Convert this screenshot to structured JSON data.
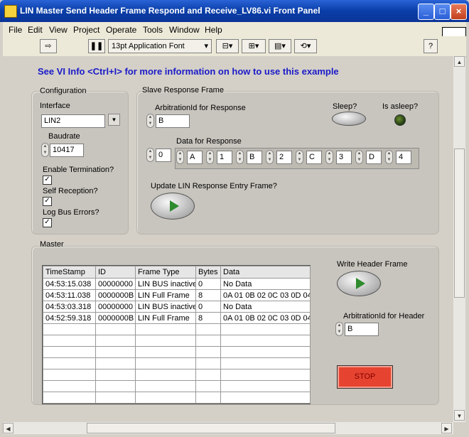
{
  "window": {
    "title": "LIN Master Send Header Frame Respond and Receive_LV86.vi Front Panel"
  },
  "menu": [
    "File",
    "Edit",
    "View",
    "Project",
    "Operate",
    "Tools",
    "Window",
    "Help"
  ],
  "toolbar": {
    "font_label": "13pt Application Font"
  },
  "info_text": "See VI Info <Ctrl+I> for more information on how to use this example",
  "configuration": {
    "title": "Configuration",
    "interface_label": "Interface",
    "interface_value": "LIN2",
    "baudrate_label": "Baudrate",
    "baudrate_value": "10417",
    "enable_termination_label": "Enable Termination?",
    "self_reception_label": "Self Reception?",
    "log_bus_errors_label": "Log Bus Errors?",
    "check_mark": "✓"
  },
  "slave": {
    "title": "Slave Response Frame",
    "arb_id_label": "ArbitrationId for Response",
    "arb_id_value": "B",
    "sleep_label": "Sleep?",
    "asleep_label": "Is asleep?",
    "data_label": "Data for Response",
    "data_index": "0",
    "data_values": [
      "A",
      "1",
      "B",
      "2",
      "C",
      "3",
      "D",
      "4"
    ],
    "update_label": "Update LIN Response Entry Frame?"
  },
  "master": {
    "title": "Master",
    "columns": [
      "TimeStamp",
      "ID",
      "Frame Type",
      "Bytes",
      "Data"
    ],
    "rows": [
      [
        "04:53:15.038",
        "00000000",
        "LIN BUS inactive",
        "0",
        "No Data"
      ],
      [
        "04:53:11.038",
        "0000000B",
        "LIN Full Frame",
        "8",
        "0A 01 0B 02 0C 03 0D 04"
      ],
      [
        "04:53:03.318",
        "00000000",
        "LIN BUS inactive",
        "0",
        "No Data"
      ],
      [
        "04:52:59.318",
        "0000000B",
        "LIN Full Frame",
        "8",
        "0A 01 0B 02 0C 03 0D 04"
      ]
    ],
    "write_header_label": "Write Header Frame",
    "arb_header_label": "ArbitrationId for Header",
    "arb_header_value": "B",
    "stop_label": "STOP"
  },
  "colors": {
    "title_bar": "#0a3ea8",
    "info_text": "#1a1ac8",
    "stop_button": "#e64430",
    "led_off": "#1d3a10",
    "arrow_green": "#2e8b2e"
  }
}
